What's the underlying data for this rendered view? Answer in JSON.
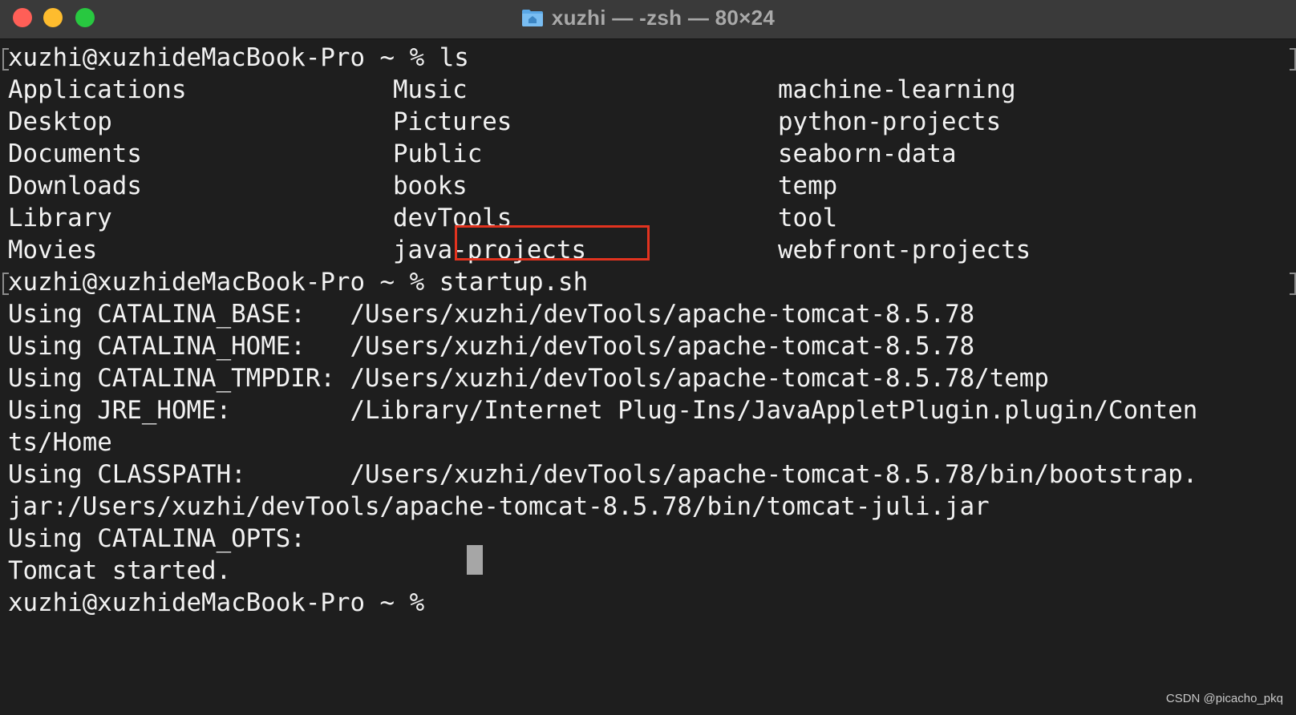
{
  "window": {
    "title": "xuzhi — -zsh — 80×24",
    "accent": {
      "close": "#ff5f57",
      "minimize": "#febc2e",
      "zoom": "#28c840",
      "highlight": "#e2331f"
    }
  },
  "terminal": {
    "prompt1": "xuzhi@xuzhideMacBook-Pro ~ % ls",
    "ls_rows": [
      [
        "Applications",
        "Music",
        "machine-learning"
      ],
      [
        "Desktop",
        "Pictures",
        "python-projects"
      ],
      [
        "Documents",
        "Public",
        "seaborn-data"
      ],
      [
        "Downloads",
        "books",
        "temp"
      ],
      [
        "Library",
        "devTools",
        "tool"
      ],
      [
        "Movies",
        "java-projects",
        "webfront-projects"
      ]
    ],
    "prompt2": "xuzhi@xuzhideMacBook-Pro ~ % startup.sh",
    "output_lines": [
      "Using CATALINA_BASE:   /Users/xuzhi/devTools/apache-tomcat-8.5.78",
      "Using CATALINA_HOME:   /Users/xuzhi/devTools/apache-tomcat-8.5.78",
      "Using CATALINA_TMPDIR: /Users/xuzhi/devTools/apache-tomcat-8.5.78/temp",
      "Using JRE_HOME:        /Library/Internet Plug-Ins/JavaAppletPlugin.plugin/Conten",
      "ts/Home",
      "Using CLASSPATH:       /Users/xuzhi/devTools/apache-tomcat-8.5.78/bin/bootstrap.",
      "jar:/Users/xuzhi/devTools/apache-tomcat-8.5.78/bin/tomcat-juli.jar",
      "Using CATALINA_OPTS:",
      "Tomcat started."
    ],
    "prompt3": "xuzhi@xuzhideMacBook-Pro ~ % "
  },
  "watermark": "CSDN @picacho_pkq"
}
